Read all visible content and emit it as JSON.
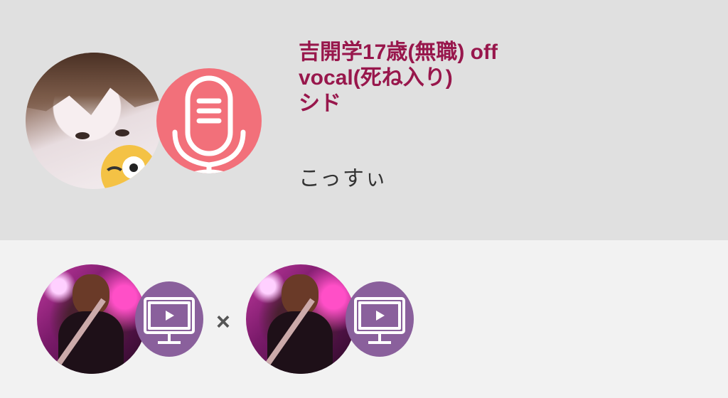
{
  "profile": {
    "title_lines": [
      "吉開学17歳(無職) off",
      "vocal(死ね入り)",
      "シド"
    ],
    "subtitle": "こっすぃ"
  },
  "separator": "×",
  "icons": {
    "mic": "microphone-icon",
    "tv": "monitor-play-icon"
  },
  "colors": {
    "title": "#98174c",
    "mic_badge": "#f2707a",
    "tv_badge": "#8a609c",
    "top_bg": "#e0e0e0",
    "bottom_bg": "#f2f2f2"
  }
}
